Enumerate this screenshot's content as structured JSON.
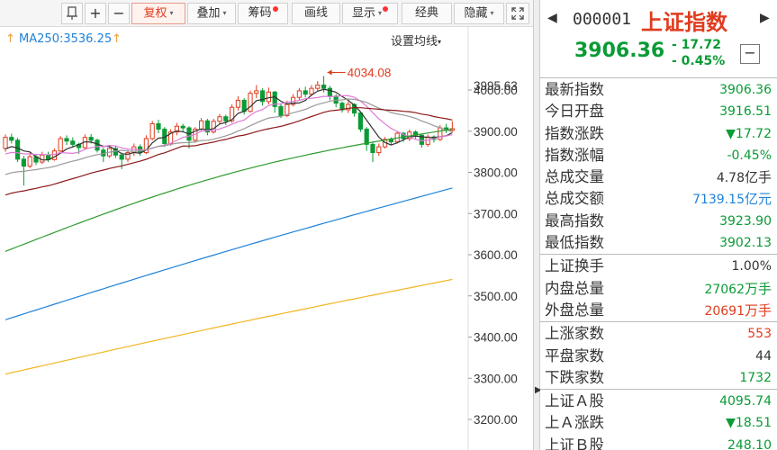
{
  "toolbar": {
    "items": [
      {
        "label": "",
        "icon": "pin-icon"
      },
      {
        "label": "+"
      },
      {
        "label": "−"
      },
      {
        "label": "复权",
        "caret": "▾",
        "active": true
      },
      {
        "label": "叠加",
        "caret": "▾"
      },
      {
        "label": "筹码",
        "dot": true
      },
      {
        "label": "画线"
      },
      {
        "label": "显示",
        "caret": "▾",
        "dot": true
      },
      {
        "label": "经典"
      },
      {
        "label": "隐藏",
        "caret": "▾"
      },
      {
        "label": "",
        "icon": "fullscreen-icon"
      }
    ]
  },
  "chart": {
    "ma_label": "MA250:3536.25",
    "ma_arrow": "↑",
    "settings_label": "设置均线",
    "settings_caret": "▾",
    "high_annotation": "4034.08",
    "price_tag": "3995.63",
    "colors": {
      "up": "#e03c1f",
      "down": "#0a9b36",
      "ma5": "#333333",
      "ma10": "#e07bd8",
      "ma20": "#999999",
      "ma30": "#8c1a1a",
      "ma60": "#2e9b2e",
      "ma120": "#1f82d8",
      "ma250": "#f2b51f"
    }
  },
  "chart_data": {
    "type": "candlestick",
    "ylim": [
      3180,
      4080
    ],
    "y_ticks": [
      "4000.00",
      "3900.00",
      "3800.00",
      "3700.00",
      "3600.00",
      "3500.00",
      "3400.00",
      "3300.00",
      "3200.00"
    ],
    "y_tick_values": [
      4000,
      3900,
      3800,
      3700,
      3600,
      3500,
      3400,
      3300,
      3200
    ],
    "candles": [
      [
        3858,
        3885,
        3850,
        3892
      ],
      [
        3885,
        3878,
        3870,
        3894
      ],
      [
        3878,
        3832,
        3825,
        3884
      ],
      [
        3832,
        3815,
        3768,
        3840
      ],
      [
        3815,
        3838,
        3810,
        3848
      ],
      [
        3838,
        3825,
        3818,
        3845
      ],
      [
        3825,
        3842,
        3820,
        3850
      ],
      [
        3842,
        3831,
        3825,
        3850
      ],
      [
        3831,
        3852,
        3828,
        3858
      ],
      [
        3852,
        3882,
        3848,
        3888
      ],
      [
        3882,
        3876,
        3866,
        3890
      ],
      [
        3876,
        3868,
        3860,
        3885
      ],
      [
        3868,
        3860,
        3845,
        3872
      ],
      [
        3860,
        3885,
        3855,
        3892
      ],
      [
        3885,
        3878,
        3870,
        3893
      ],
      [
        3878,
        3854,
        3848,
        3882
      ],
      [
        3854,
        3840,
        3825,
        3860
      ],
      [
        3840,
        3858,
        3835,
        3866
      ],
      [
        3858,
        3842,
        3835,
        3864
      ],
      [
        3842,
        3832,
        3808,
        3848
      ],
      [
        3832,
        3848,
        3825,
        3855
      ],
      [
        3848,
        3862,
        3840,
        3870
      ],
      [
        3862,
        3848,
        3840,
        3868
      ],
      [
        3848,
        3882,
        3844,
        3890
      ],
      [
        3882,
        3918,
        3878,
        3925
      ],
      [
        3918,
        3905,
        3895,
        3928
      ],
      [
        3905,
        3870,
        3862,
        3910
      ],
      [
        3870,
        3898,
        3865,
        3905
      ],
      [
        3898,
        3912,
        3890,
        3920
      ],
      [
        3912,
        3908,
        3898,
        3918
      ],
      [
        3908,
        3878,
        3858,
        3912
      ],
      [
        3878,
        3905,
        3872,
        3910
      ],
      [
        3905,
        3925,
        3900,
        3932
      ],
      [
        3925,
        3898,
        3890,
        3930
      ],
      [
        3898,
        3924,
        3894,
        3930
      ],
      [
        3924,
        3935,
        3918,
        3942
      ],
      [
        3935,
        3925,
        3915,
        3940
      ],
      [
        3925,
        3958,
        3920,
        3965
      ],
      [
        3958,
        3975,
        3950,
        3985
      ],
      [
        3975,
        3948,
        3940,
        3980
      ],
      [
        3948,
        3992,
        3945,
        3998
      ],
      [
        3992,
        3998,
        3980,
        4012
      ],
      [
        3998,
        3972,
        3962,
        4004
      ],
      [
        3972,
        3995,
        3965,
        4006
      ],
      [
        3995,
        3960,
        3945,
        3998
      ],
      [
        3960,
        3938,
        3932,
        3968
      ],
      [
        3938,
        3965,
        3934,
        3974
      ],
      [
        3965,
        3982,
        3960,
        3990
      ],
      [
        3982,
        3998,
        3975,
        4005
      ],
      [
        3998,
        3990,
        3982,
        4008
      ],
      [
        3990,
        4004,
        3985,
        4012
      ],
      [
        4004,
        4012,
        3998,
        4022
      ],
      [
        4012,
        4004,
        3994,
        4034
      ],
      [
        4004,
        3985,
        3975,
        4010
      ],
      [
        3985,
        3968,
        3958,
        3990
      ],
      [
        3968,
        3952,
        3945,
        3972
      ],
      [
        3952,
        3965,
        3944,
        3972
      ],
      [
        3965,
        3944,
        3935,
        3968
      ],
      [
        3944,
        3905,
        3898,
        3948
      ],
      [
        3905,
        3868,
        3852,
        3910
      ],
      [
        3868,
        3848,
        3825,
        3872
      ],
      [
        3848,
        3862,
        3840,
        3870
      ],
      [
        3862,
        3880,
        3858,
        3886
      ],
      [
        3880,
        3874,
        3866,
        3885
      ],
      [
        3874,
        3895,
        3870,
        3900
      ],
      [
        3895,
        3882,
        3874,
        3898
      ],
      [
        3882,
        3898,
        3876,
        3904
      ],
      [
        3898,
        3890,
        3882,
        3902
      ],
      [
        3890,
        3868,
        3860,
        3894
      ],
      [
        3868,
        3886,
        3862,
        3892
      ],
      [
        3886,
        3880,
        3872,
        3890
      ],
      [
        3880,
        3908,
        3876,
        3915
      ],
      [
        3908,
        3902,
        3895,
        3918
      ],
      [
        3902,
        3906,
        3898,
        3924
      ]
    ]
  },
  "panel": {
    "nav_left": "◀",
    "nav_right": "▶",
    "code": "000001",
    "name": "上证指数",
    "price": "3906.36",
    "change": "- 17.72",
    "change_pct": "- 0.45%",
    "minus_button": "−",
    "groups": [
      [
        {
          "label": "最新指数",
          "value": "3906.36",
          "color": "green"
        },
        {
          "label": "今日开盘",
          "value": "3916.51",
          "color": "green"
        },
        {
          "label": "指数涨跌",
          "value": "▼17.72",
          "color": "green"
        },
        {
          "label": "指数涨幅",
          "value": "-0.45%",
          "color": "green"
        },
        {
          "label": "总成交量",
          "value": "4.78",
          "unit": "亿手",
          "color": ""
        },
        {
          "label": "总成交额",
          "value": "7139.15",
          "unit": "亿元",
          "color": "blue"
        },
        {
          "label": "最高指数",
          "value": "3923.90",
          "color": "green"
        },
        {
          "label": "最低指数",
          "value": "3902.13",
          "color": "green"
        }
      ],
      [
        {
          "label": "上证换手",
          "value": "1.00%",
          "color": ""
        },
        {
          "label": "内盘总量",
          "value": "27062",
          "unit": "万手",
          "color": "green"
        },
        {
          "label": "外盘总量",
          "value": "20691",
          "unit": "万手",
          "color": "red"
        }
      ],
      [
        {
          "label": "上涨家数",
          "value": "553",
          "color": "red"
        },
        {
          "label": "平盘家数",
          "value": "44",
          "color": ""
        },
        {
          "label": "下跌家数",
          "value": "1732",
          "color": "green"
        }
      ],
      [
        {
          "label": "上证Ａ股",
          "value": "4095.74",
          "color": "green"
        },
        {
          "label": "上Ａ涨跌",
          "value": "▼18.51",
          "color": "green"
        },
        {
          "label": "上证Ｂ股",
          "value": "248.10",
          "color": "green"
        }
      ]
    ]
  }
}
